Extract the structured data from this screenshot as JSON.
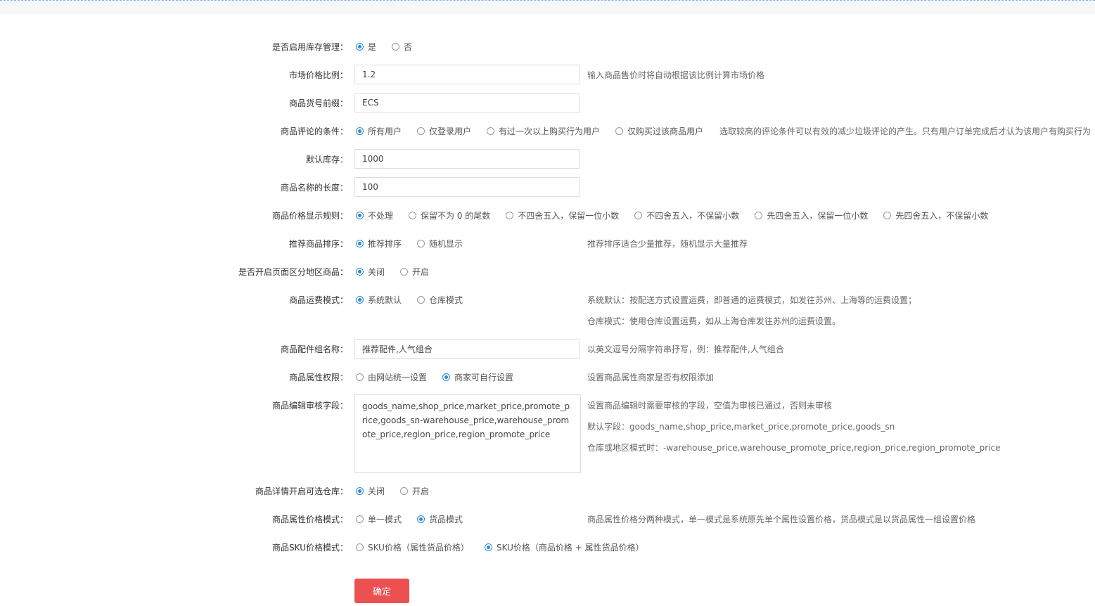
{
  "form": {
    "stock_mgmt": {
      "label": "是否启用库存管理：",
      "options": [
        "是",
        "否"
      ]
    },
    "market_ratio": {
      "label": "市场价格比例：",
      "value": "1.2",
      "hint": "输入商品售价时将自动根据该比例计算市场价格"
    },
    "sn_prefix": {
      "label": "商品货号前缀：",
      "value": "ECS"
    },
    "comment_cond": {
      "label": "商品评论的条件：",
      "options": [
        "所有用户",
        "仅登录用户",
        "有过一次以上购买行为用户",
        "仅购买过该商品用户"
      ],
      "hint": "选取较高的评论条件可以有效的减少垃圾评论的产生。只有用户订单完成后才认为该用户有购买行为"
    },
    "default_stock": {
      "label": "默认库存：",
      "value": "1000"
    },
    "name_length": {
      "label": "商品名称的长度：",
      "value": "100"
    },
    "price_rule": {
      "label": "商品价格显示规则：",
      "options": [
        "不处理",
        "保留不为 0 的尾数",
        "不四舍五入，保留一位小数",
        "不四舍五入，不保留小数",
        "先四舍五入，保留一位小数",
        "先四舍五入，不保留小数"
      ]
    },
    "recommend_sort": {
      "label": "推荐商品排序：",
      "options": [
        "推荐排序",
        "随机显示"
      ],
      "hint": "推荐排序适合少量推荐，随机显示大量推荐"
    },
    "region_goods": {
      "label": "是否开启页面区分地区商品：",
      "options": [
        "关闭",
        "开启"
      ]
    },
    "freight_mode": {
      "label": "商品运费模式：",
      "options": [
        "系统默认",
        "仓库模式"
      ],
      "hint1": "系统默认：按配送方式设置运费，即普通的运费模式，如发往苏州、上海等的运费设置；",
      "hint2": "仓库模式：使用仓库设置运费，如从上海仓库发往苏州的运费设置。"
    },
    "accessory_name": {
      "label": "商品配件组名称：",
      "value": "推荐配件,人气组合",
      "hint": "以英文逗号分隔字符串抒写，例：推荐配件,人气组合"
    },
    "attr_permission": {
      "label": "商品属性权限：",
      "options": [
        "由网站统一设置",
        "商家可自行设置"
      ],
      "hint": "设置商品属性商家是否有权限添加"
    },
    "edit_review": {
      "label": "商品编辑审核字段：",
      "value": "goods_name,shop_price,market_price,promote_price,goods_sn-warehouse_price,warehouse_promote_price,region_price,region_promote_price",
      "hint1": "设置商品编辑时需要审核的字段，空值为审核已通过，否则未审核",
      "hint2": "默认字段：goods_name,shop_price,market_price,promote_price,goods_sn",
      "hint3": "仓库或地区模式时：-warehouse_price,warehouse_promote_price,region_price,region_promote_price"
    },
    "detail_warehouse": {
      "label": "商品详情开启可选仓库：",
      "options": [
        "关闭",
        "开启"
      ]
    },
    "attr_price_mode": {
      "label": "商品属性价格模式：",
      "options": [
        "单一模式",
        "货品模式"
      ],
      "hint": "商品属性价格分两种模式，单一模式是系统原先单个属性设置价格，货品模式是以货品属性一组设置价格"
    },
    "sku_price_mode": {
      "label": "商品SKU价格模式：",
      "options": [
        "SKU价格（属性货品价格）",
        "SKU价格（商品价格 + 属性货品价格）"
      ]
    }
  },
  "submit_label": "确定"
}
